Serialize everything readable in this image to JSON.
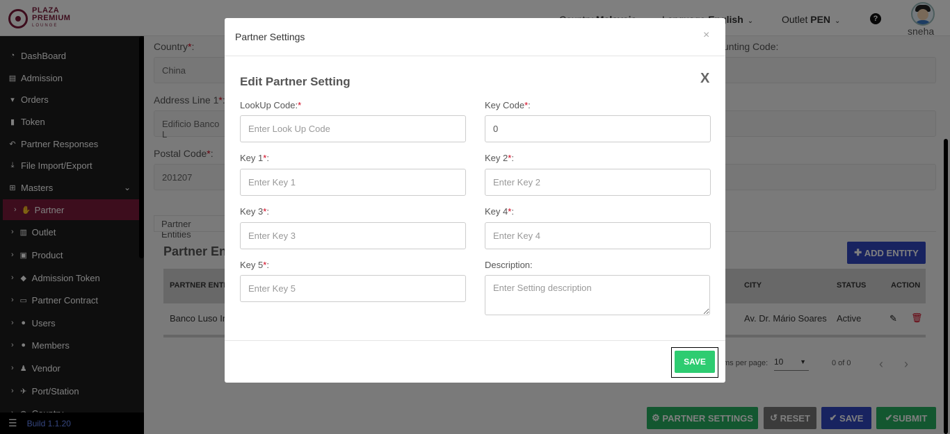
{
  "header": {
    "logo": {
      "line1": "PLAZA",
      "line2": "PREMIUM",
      "line3": "LOUNGE"
    },
    "country_label": "Country",
    "country_value": "Malaysia",
    "language_label": "Language",
    "language_value": "English",
    "outlet_label": "Outlet",
    "outlet_value": "PEN",
    "help_icon": "?",
    "username": "sneha"
  },
  "sidebar": {
    "items": [
      {
        "label": "DashBoard",
        "icon": "dashboard-icon",
        "glyph": "◔"
      },
      {
        "label": "Admission",
        "icon": "id-card-icon",
        "glyph": "▤"
      },
      {
        "label": "Orders",
        "icon": "cart-icon",
        "glyph": "🛒"
      },
      {
        "label": "Token",
        "icon": "file-icon",
        "glyph": "▮"
      },
      {
        "label": "Partner Responses",
        "icon": "reply-icon",
        "glyph": "↶"
      },
      {
        "label": "File Import/Export",
        "icon": "download-icon",
        "glyph": "⤓"
      },
      {
        "label": "Masters",
        "icon": "sitemap-icon",
        "glyph": "⊞"
      }
    ],
    "sub_items": [
      {
        "label": "Partner",
        "icon": "handshake-icon",
        "glyph": "✋"
      },
      {
        "label": "Outlet",
        "icon": "building-icon",
        "glyph": "▥"
      },
      {
        "label": "Product",
        "icon": "gift-icon",
        "glyph": "▣"
      },
      {
        "label": "Admission Token",
        "icon": "ticket-icon",
        "glyph": "◆"
      },
      {
        "label": "Partner Contract",
        "icon": "briefcase-icon",
        "glyph": "▭"
      },
      {
        "label": "Users",
        "icon": "user-icon",
        "glyph": "●"
      },
      {
        "label": "Members",
        "icon": "users-icon",
        "glyph": "●"
      },
      {
        "label": "Vendor",
        "icon": "person-icon",
        "glyph": "♟"
      },
      {
        "label": "Port/Station",
        "icon": "plane-icon",
        "glyph": "✈"
      },
      {
        "label": "Country",
        "icon": "globe-icon",
        "glyph": "◍"
      }
    ],
    "build": "Build 1.1.20"
  },
  "form": {
    "country_label": "Country",
    "country_value": "China",
    "address_label": "Address Line 1",
    "address_value": "Edificio Banco L",
    "postal_label": "Postal Code",
    "postal_value": "201207",
    "accounting_label": "unting Code:",
    "tab_label": "Partner Entities",
    "section_title": "Partner En",
    "add_entity": "ADD ENTITY",
    "columns": {
      "entity": "PARTNER ENTITI",
      "city": "CITY",
      "status": "STATUS",
      "action": "ACTION"
    },
    "row": {
      "entity": "Banco Luso In",
      "city": "Av. Dr. Mário Soares",
      "status": "Active"
    },
    "pager": {
      "items_per_page": "ms per page:",
      "page_size": "10",
      "range": "0 of 0"
    }
  },
  "bottom_buttons": {
    "partner_settings": "PARTNER SETTINGS",
    "reset": "RESET",
    "save": "SAVE",
    "submit": "SUBMIT"
  },
  "modal": {
    "title": "Partner Settings",
    "close": "×",
    "subtitle": "Edit Partner Setting",
    "x": "X",
    "fields": {
      "lookup_label": "LookUp Code:",
      "lookup_placeholder": "Enter Look Up Code",
      "keycode_label": "Key Code",
      "keycode_value": "0",
      "key1_label": "Key 1",
      "key1_placeholder": "Enter Key 1",
      "key2_label": "Key 2",
      "key2_placeholder": "Enter Key 2",
      "key3_label": "Key 3",
      "key3_placeholder": "Enter Key 3",
      "key4_label": "Key 4",
      "key4_placeholder": "Enter Key 4",
      "key5_label": "Key 5",
      "key5_placeholder": "Enter Key 5",
      "desc_label": "Description:",
      "desc_placeholder": "Enter Setting description"
    },
    "save": "SAVE"
  },
  "colors": {
    "brand": "#7a1a3a",
    "primary": "#3046c1",
    "success": "#2ecc71",
    "sidebar_bg": "#1c1c1c",
    "required": "#d0021b"
  }
}
